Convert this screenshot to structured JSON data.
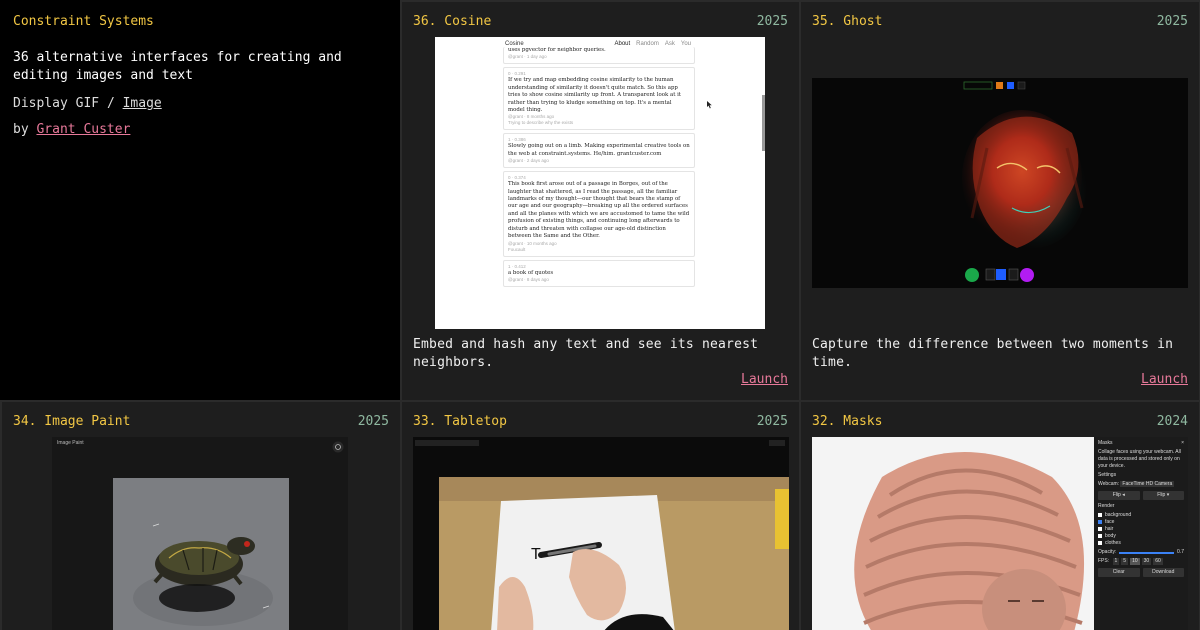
{
  "intro": {
    "site_title": "Constraint Systems",
    "tagline": "36 alternative interfaces for creating and editing images and text",
    "display_prefix": "Display",
    "gif_label": "GIF",
    "separator": "/",
    "image_label": "Image",
    "by_prefix": "by",
    "author": "Grant Custer"
  },
  "projects": [
    {
      "title": "36. Cosine",
      "year": "2025",
      "description": "Embed and hash any text and see its nearest neighbors.",
      "launch": "Launch",
      "screenshot": {
        "app_name": "Cosine",
        "nav": [
          "About",
          "Random",
          "Ask",
          "You"
        ],
        "top_snippet": "uses pgvector for neighbor queries.",
        "cards": [
          {
            "meta_top": "@grant · 1 day ago",
            "body": "",
            "meta_bottom": ""
          },
          {
            "meta_top": "0 · 0.291",
            "body": "If we try and map embedding cosine similarity to the human understanding of similarity it doesn't quite match. So this app tries to show cosine similarity up front. A transparent look at it rather than trying to kludge something on top. It's a mental model thing.",
            "meta_bottom": "@grant · 8 months ago",
            "extra": "Trying to describe why the exists"
          },
          {
            "meta_top": "1 · 0.386",
            "body": "Slowly going out on a limb. Making experimental creative tools on the web at constraint.systems. He/him. grantcuster.com",
            "meta_bottom": "@grant · 2 days ago"
          },
          {
            "meta_top": "0 · 0.374",
            "body": "This book first arose out of a passage in Borges, out of the laughter that shattered, as I read the passage, all the familiar landmarks of my thought—our thought that bears the stamp of our age and our geography—breaking up all the ordered surfaces and all the planes with which we are accustomed to tame the wild profusion of existing things, and continuing long afterwards to disturb and threaten with collapse our age-old distinction between the Same and the Other.",
            "meta_bottom": "@grant · 10 months ago",
            "extra": "Foucault"
          },
          {
            "meta_top": "1 · 0.412",
            "body": "a book of quotes",
            "meta_bottom": "@grant · 8 days ago"
          }
        ]
      }
    },
    {
      "title": "35. Ghost",
      "year": "2025",
      "description": "Capture the difference between two moments in time.",
      "launch": "Launch"
    },
    {
      "title": "34. Image Paint",
      "year": "2025",
      "screenshot": {
        "app_name": "Image Paint"
      }
    },
    {
      "title": "33. Tabletop",
      "year": "2025"
    },
    {
      "title": "32. Masks",
      "year": "2024",
      "screenshot": {
        "app_name": "Masks",
        "close": "×",
        "intro": "Collage faces using your webcam. All data is processed and stored only on your device.",
        "settings_label": "Settings",
        "webcam_label": "Webcam:",
        "webcam_value": "FaceTime HD Camera",
        "flip_h": "Flip ◂",
        "flip_v": "Flip ▾",
        "render_label": "Render",
        "render_options": [
          {
            "label": "background",
            "checked": false
          },
          {
            "label": "face",
            "checked": true
          },
          {
            "label": "hair",
            "checked": false
          },
          {
            "label": "body",
            "checked": false
          },
          {
            "label": "clothes",
            "checked": false
          }
        ],
        "opacity_label": "Opacity:",
        "opacity_value": "0.7",
        "fps_label": "FPS:",
        "fps_options": [
          "1",
          "5",
          "10",
          "30",
          "60"
        ],
        "clear": "Clear",
        "download": "Download"
      }
    }
  ],
  "colors": {
    "title": "#f2c744",
    "year": "#8fb8a0",
    "link": "#e8799a",
    "cell_bg": "#1e1e1e",
    "intro_bg": "#000000"
  }
}
